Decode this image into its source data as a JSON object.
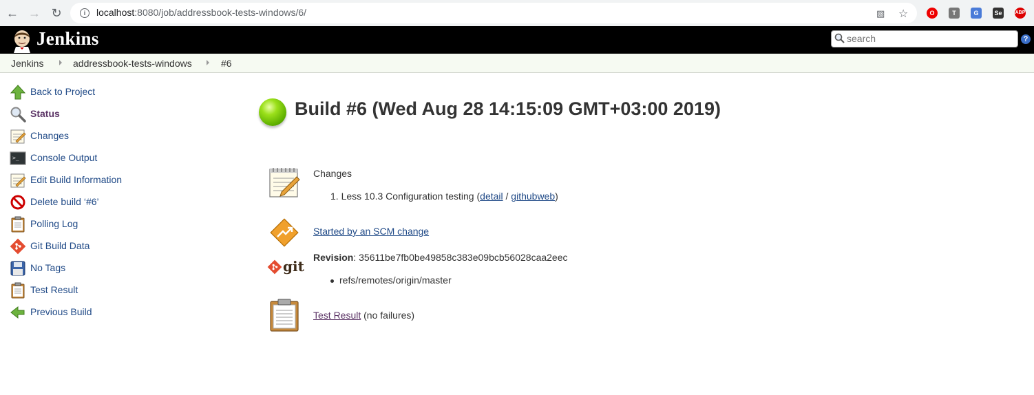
{
  "browser": {
    "url_host": "localhost",
    "url_rest": ":8080/job/addressbook-tests-windows/6/",
    "extensions": [
      "opera-icon",
      "T",
      "google-translate-icon",
      "Se",
      "ABP"
    ]
  },
  "header": {
    "app_name": "Jenkins",
    "search_placeholder": "search",
    "help_label": "?"
  },
  "breadcrumb": {
    "items": [
      "Jenkins",
      "addressbook-tests-windows",
      "#6"
    ]
  },
  "sidebar": {
    "items": [
      {
        "label": "Back to Project",
        "icon": "up-arrow-icon"
      },
      {
        "label": "Status",
        "icon": "magnifier-icon"
      },
      {
        "label": "Changes",
        "icon": "notepad-icon"
      },
      {
        "label": "Console Output",
        "icon": "terminal-icon"
      },
      {
        "label": "Edit Build Information",
        "icon": "notepad-icon"
      },
      {
        "label": "Delete build ‘#6’",
        "icon": "no-entry-icon"
      },
      {
        "label": "Polling Log",
        "icon": "clipboard-icon"
      },
      {
        "label": "Git Build Data",
        "icon": "git-icon"
      },
      {
        "label": "No Tags",
        "icon": "floppy-icon"
      },
      {
        "label": "Test Result",
        "icon": "clipboard-icon"
      },
      {
        "label": "Previous Build",
        "icon": "left-arrow-icon"
      }
    ]
  },
  "build": {
    "title": "Build #6 (Wed Aug 28 14:15:09 GMT+03:00 2019)",
    "status_color": "#5fb000",
    "changes": {
      "heading": "Changes",
      "items": [
        {
          "number": "1.",
          "text": "Less 10.3 Configuration testing (",
          "detail": "detail",
          "sep": " / ",
          "web": "githubweb",
          "close": ")"
        }
      ]
    },
    "cause": "Started by an SCM change",
    "git": {
      "logo_text": "git",
      "revision_label": "Revision",
      "revision_value": ": 35611be7fb0be49858c383e09bcb56028caa2eec",
      "branches": [
        "refs/remotes/origin/master"
      ]
    },
    "test_result": {
      "link": "Test Result",
      "suffix": "(no failures)"
    }
  }
}
